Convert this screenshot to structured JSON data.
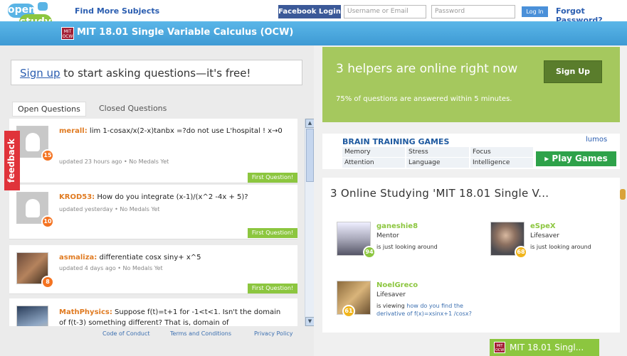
{
  "header": {
    "logo_top": "open",
    "logo_bottom": "study",
    "find_more": "Find More Subjects",
    "facebook_login": "Facebook Login",
    "username_placeholder": "Username or Email",
    "password_placeholder": "Password",
    "login_button": "Log In",
    "forgot_password": "Forgot Password?"
  },
  "course": {
    "badge": "MIT OCW",
    "title": "MIT 18.01 Single Variable Calculus (OCW)"
  },
  "signup": {
    "link": "Sign up",
    "text": " to start asking questions—it's free!"
  },
  "tabs": {
    "open": "Open Questions",
    "closed": "Closed Questions"
  },
  "feedback": "feedback",
  "questions": [
    {
      "user": "merall:",
      "text": " lim 1-cosax/x(2-x)tanbx =?do not use L'hospital ! x→0",
      "meta": "updated 23 hours ago • No Medals Yet",
      "score": "15",
      "tag": "First Question!"
    },
    {
      "user": "KROD53:",
      "text": " How do you integrate (x-1)/(x^2 -4x + 5)?",
      "meta": "updated yesterday • No Medals Yet",
      "score": "10",
      "tag": "First Question!"
    },
    {
      "user": "asmaliza:",
      "text": " differentiate cosx siny+ x^5",
      "meta": "updated 4 days ago • No Medals Yet",
      "score": "8",
      "tag": "First Question!"
    },
    {
      "user": "MathPhysics:",
      "text": " Suppose f(t)=t+1 for -1<t<1. Isn't the domain of f(t-3) something different? That is, domain of",
      "meta": "",
      "score": "",
      "tag": ""
    }
  ],
  "footer": {
    "conduct": "Code of Conduct",
    "terms": "Terms and Conditions",
    "privacy": "Privacy Policy"
  },
  "helpers": {
    "headline": "3 helpers are online right now",
    "sub": "75% of questions are answered within 5 minutes.",
    "button": "Sign Up"
  },
  "ad": {
    "title": "BRAIN TRAINING GAMES",
    "brand": "lumos",
    "cells": [
      "Memory",
      "Stress",
      "Focus",
      "Attention",
      "Language",
      "Intelligence"
    ],
    "play": "▸ Play Games"
  },
  "online": {
    "heading": "3 Online Studying 'MIT 18.01 Single V...",
    "members": [
      {
        "name": "ganeshie8",
        "role": "Mentor",
        "status": "is just looking around",
        "score": "94",
        "link": ""
      },
      {
        "name": "eSpeX",
        "role": "Lifesaver",
        "status": "is just looking around",
        "score": "68",
        "link": ""
      },
      {
        "name": "NoelGreco",
        "role": "Lifesaver",
        "status": "is viewing ",
        "score": "61",
        "link": "how do you find the derivative of f(x)=xsinx+1 /cosx?"
      }
    ]
  },
  "chat": {
    "label": "MIT 18.01 Singl..."
  },
  "colors": {
    "accent_blue": "#4aa8de",
    "green": "#8cc63f",
    "orange_badge": "#f47321",
    "feedback_red": "#e0333a"
  }
}
